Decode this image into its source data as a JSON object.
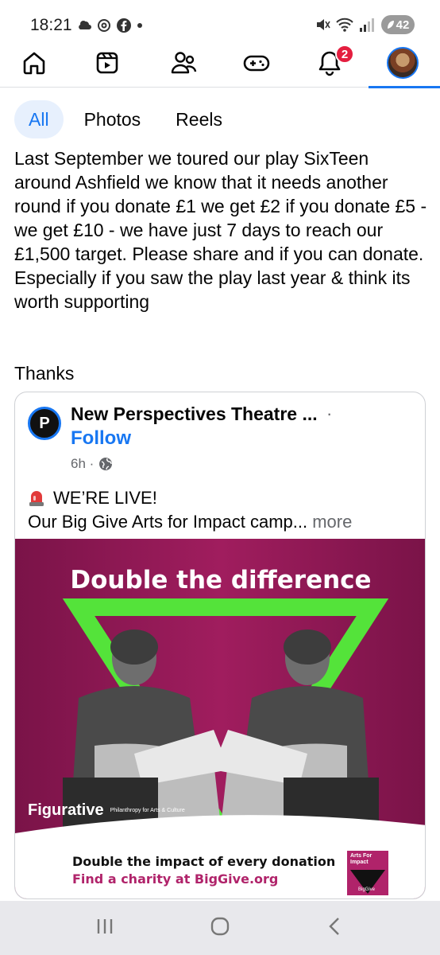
{
  "status_bar": {
    "time": "18:21",
    "left_icons": [
      "weather-icon",
      "threads-icon",
      "facebook-icon",
      "dot-icon"
    ],
    "right_icons": [
      "mute-icon",
      "wifi-icon",
      "signal-icon"
    ],
    "battery": "42"
  },
  "nav": {
    "items": [
      "home-icon",
      "video-icon",
      "friends-icon",
      "gaming-icon",
      "bell-icon",
      "profile-avatar"
    ],
    "notification_count": "2",
    "active": "profile",
    "accent": "#1877f2"
  },
  "filters": {
    "tabs": [
      {
        "label": "All",
        "active": true
      },
      {
        "label": "Photos",
        "active": false
      },
      {
        "label": "Reels",
        "active": false
      }
    ]
  },
  "post": {
    "text": "Last September we toured our play SixTeen around Ashfield we know that it needs another round if you donate £1 we get £2 if you donate £5 - we get £10 - we have just 7 days to reach our £1,500 target. Please share and if you can donate. Especially if you saw the play last year & think its worth supporting",
    "thanks": "Thanks"
  },
  "shared": {
    "page_name": "New Perspectives Theatre ...",
    "more": "·",
    "follow": "Follow",
    "time": "6h ·",
    "live_text": "WE’RE LIVE!",
    "campaign_text": "Our Big Give Arts for Impact camp...",
    "more_link": "more",
    "logo_text": "P"
  },
  "promo": {
    "title": "Double the difference",
    "brand": "Figurative",
    "brand_sub": "Philanthropy for Arts & Culture",
    "line1": "Double the impact of every donation",
    "line2": "Find a charity at BigGive.org",
    "badge": "Arts For Impact",
    "badge_sub": "BigGive",
    "colors": {
      "bg": "#a01d5e",
      "triangle": "#54e33a"
    }
  },
  "android_nav": [
    "recents-icon",
    "home-circle-icon",
    "back-icon"
  ]
}
